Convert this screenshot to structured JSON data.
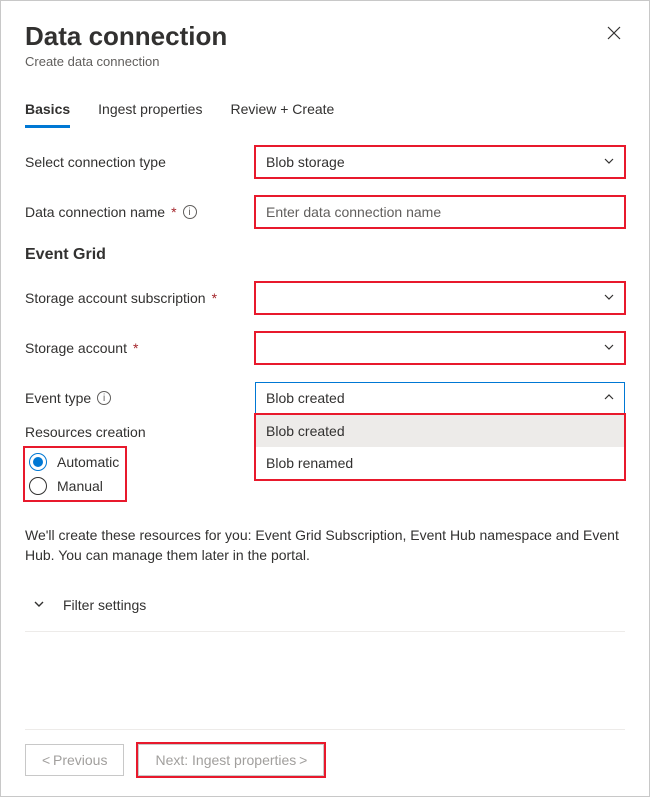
{
  "header": {
    "title": "Data connection",
    "subtitle": "Create data connection"
  },
  "tabs": {
    "basics": "Basics",
    "ingest": "Ingest properties",
    "review": "Review + Create"
  },
  "form": {
    "connection_type": {
      "label": "Select connection type",
      "value": "Blob storage"
    },
    "connection_name": {
      "label": "Data connection name",
      "placeholder": "Enter data connection name",
      "value": ""
    },
    "event_grid_heading": "Event Grid",
    "subscription": {
      "label": "Storage account subscription",
      "value": ""
    },
    "storage_account": {
      "label": "Storage account",
      "value": ""
    },
    "event_type": {
      "label": "Event type",
      "value": "Blob created",
      "options": [
        "Blob created",
        "Blob renamed"
      ]
    },
    "resources_creation": {
      "label": "Resources creation",
      "options": {
        "automatic": "Automatic",
        "manual": "Manual"
      },
      "selected": "automatic"
    },
    "help_text": "We'll create these resources for you: Event Grid Subscription, Event Hub namespace and Event Hub. You can manage them later in the portal.",
    "filter_settings": "Filter settings"
  },
  "footer": {
    "previous": "< Previous",
    "next": "Next: Ingest properties >"
  }
}
